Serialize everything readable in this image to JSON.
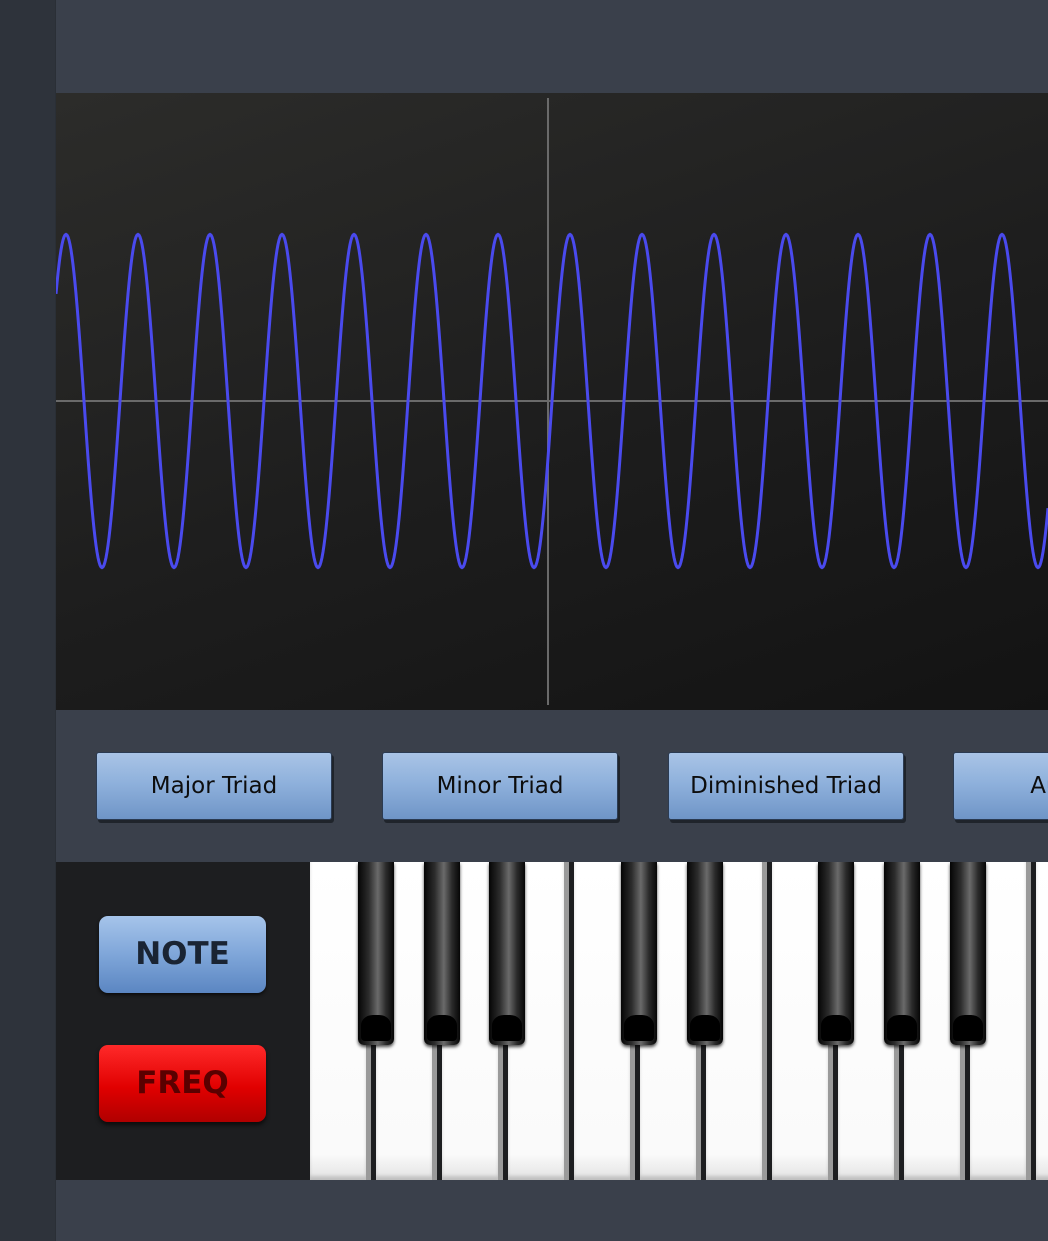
{
  "chords": {
    "items": [
      {
        "id": "major",
        "label": "Major Triad"
      },
      {
        "id": "minor",
        "label": "Minor Triad"
      },
      {
        "id": "diminished",
        "label": "Diminished Triad"
      },
      {
        "id": "augmented",
        "label": "Augme"
      }
    ]
  },
  "modes": {
    "note_label": "NOTE",
    "freq_label": "FREQ"
  },
  "scope": {
    "waveform": "sine",
    "cycles_visible": 14,
    "amplitude": 0.27,
    "color": "#4a4aee",
    "grid_color": "#6a6a6a",
    "background": "#1e1e1e"
  },
  "keyboard": {
    "white_keys_visible": 12,
    "black_key_pattern": [
      "C#",
      "D#",
      "F#",
      "G#",
      "A#",
      "C#",
      "D#",
      "F#",
      "G#"
    ]
  },
  "theme": {
    "panel": "#3a404b",
    "rail": "#2e333b",
    "button_blue": "#8fb1dc",
    "button_red": "#e10000"
  }
}
